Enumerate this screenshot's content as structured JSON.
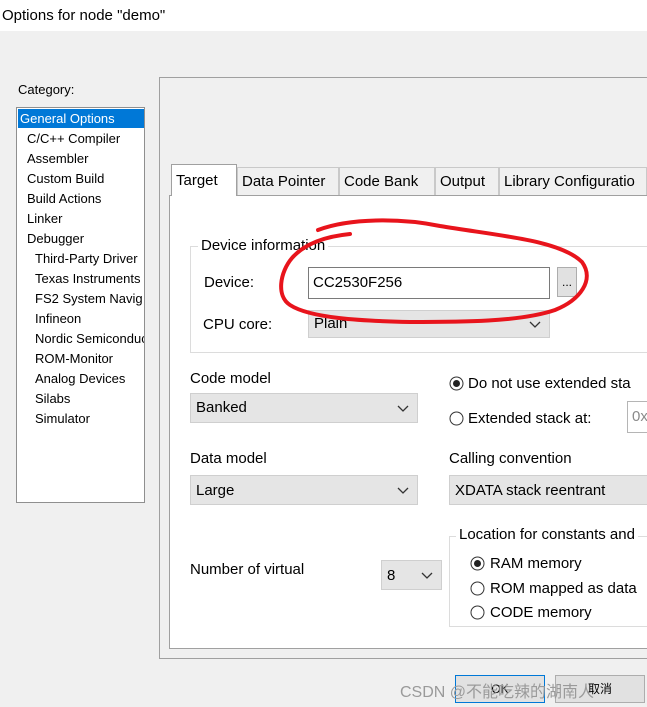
{
  "window": {
    "title": "Options for node \"demo\""
  },
  "category": {
    "label": "Category:",
    "items": [
      {
        "label": "General Options",
        "selected": true,
        "indent": 0
      },
      {
        "label": "C/C++ Compiler",
        "indent": 1
      },
      {
        "label": "Assembler",
        "indent": 1
      },
      {
        "label": "Custom Build",
        "indent": 1
      },
      {
        "label": "Build Actions",
        "indent": 1
      },
      {
        "label": "Linker",
        "indent": 1
      },
      {
        "label": "Debugger",
        "indent": 1
      },
      {
        "label": "Third-Party Driver",
        "indent": 2
      },
      {
        "label": "Texas Instruments",
        "indent": 2
      },
      {
        "label": "FS2 System Navig",
        "indent": 2
      },
      {
        "label": "Infineon",
        "indent": 2
      },
      {
        "label": "Nordic Semiconduc",
        "indent": 2
      },
      {
        "label": "ROM-Monitor",
        "indent": 2
      },
      {
        "label": "Analog Devices",
        "indent": 2
      },
      {
        "label": "Silabs",
        "indent": 2
      },
      {
        "label": "Simulator",
        "indent": 2
      }
    ]
  },
  "tabs": [
    "Target",
    "Data Pointer",
    "Code Bank",
    "Output",
    "Library Configuratio"
  ],
  "device_info": {
    "title": "Device information",
    "device_label": "Device:",
    "device_value": "CC2530F256",
    "browse_label": "...",
    "cpu_label": "CPU core:",
    "cpu_value": "Plain"
  },
  "code_model": {
    "label": "Code model",
    "value": "Banked"
  },
  "stack": {
    "option1": "Do not use extended sta",
    "option2": "Extended stack at:",
    "address_value": "0x"
  },
  "data_model": {
    "label": "Data model",
    "value": "Large"
  },
  "calling": {
    "label": "Calling convention",
    "value": "XDATA stack reentrant"
  },
  "virtual": {
    "label": "Number of virtual",
    "value": "8"
  },
  "constants": {
    "title": "Location for constants and",
    "opt_ram": "RAM memory",
    "opt_rom": "ROM mapped as data",
    "opt_code": "CODE memory"
  },
  "buttons": {
    "ok": "OK",
    "cancel": "取消"
  },
  "watermark": "CSDN @不能吃辣的湖南人",
  "colors": {
    "selection": "#0078d7",
    "annotation": "#e8141c"
  }
}
